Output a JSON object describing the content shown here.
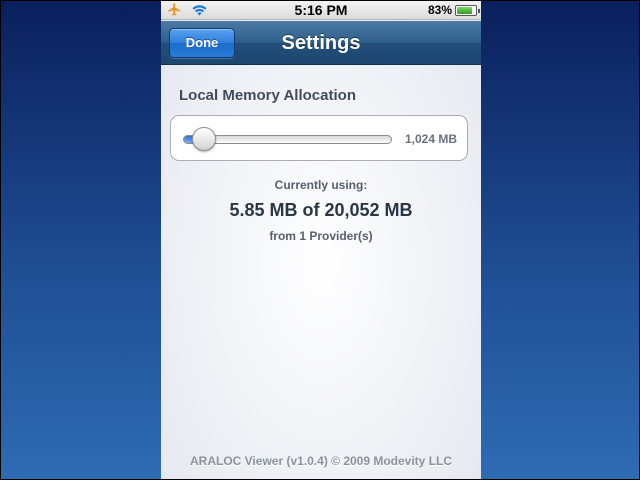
{
  "status_bar": {
    "airplane_icon": "airplane-icon",
    "wifi_icon": "wifi-icon",
    "time": "5:16 PM",
    "battery_percent": "83%",
    "battery_level": 0.83,
    "battery_icon": "battery-icon"
  },
  "nav_bar": {
    "done_label": "Done",
    "title": "Settings"
  },
  "memory": {
    "section_title": "Local Memory Allocation",
    "slider_value_label": "1,024 MB",
    "slider_fraction": 0.05,
    "currently_using_label": "Currently using:",
    "usage_text": "5.85 MB of 20,052 MB",
    "providers_text": "from 1 Provider(s)"
  },
  "footer": {
    "text": "ARALOC Viewer (v1.0.4) © 2009 Modevity LLC"
  },
  "colors": {
    "nav_bar": "#2e5f8b",
    "done_button": "#2e7fdc",
    "slider_fill": "#2f6fd0",
    "background": "#1f4d92"
  }
}
